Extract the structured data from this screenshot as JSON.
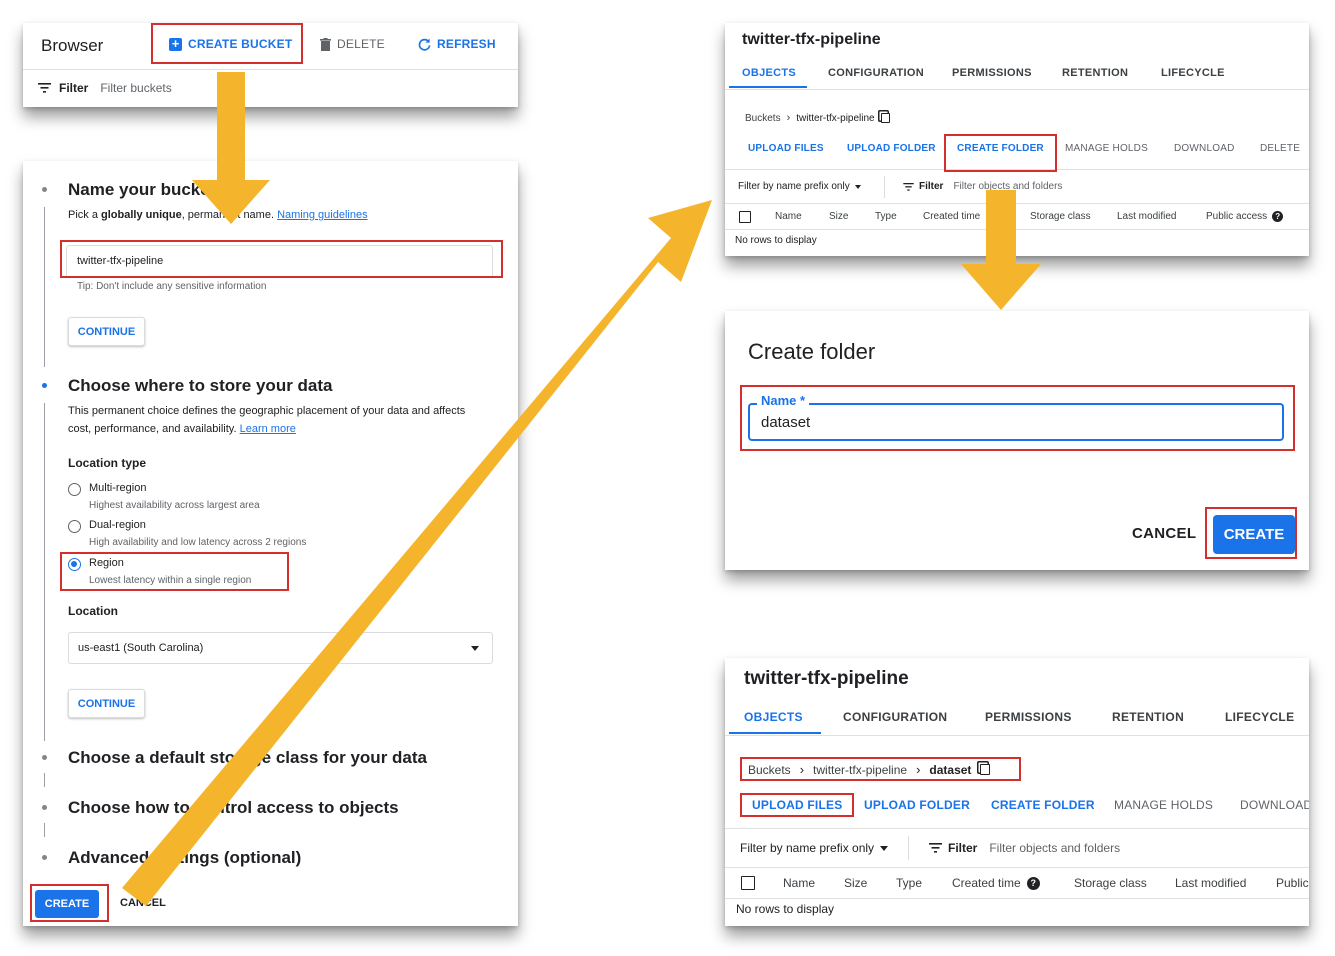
{
  "browser": {
    "title": "Browser",
    "create_bucket": "CREATE BUCKET",
    "delete": "DELETE",
    "refresh": "REFRESH",
    "filter_label": "Filter",
    "filter_placeholder": "Filter buckets"
  },
  "wizard": {
    "step1_title": "Name your bucket",
    "step1_desc_pre": "Pick a ",
    "step1_desc_bold": "globally unique",
    "step1_desc_post": ", permanent name. ",
    "step1_link": "Naming guidelines",
    "bucket_name_value": "twitter-tfx-pipeline",
    "tip": "Tip: Don't include any sensitive information",
    "continue": "CONTINUE",
    "step2_title": "Choose where to store your data",
    "step2_desc_line1": "This permanent choice defines the geographic placement of your data and affects",
    "step2_desc_line2": "cost, performance, and availability.",
    "learn_more": "Learn more",
    "location_type_label": "Location type",
    "options": [
      {
        "label": "Multi-region",
        "desc": "Highest availability across largest area"
      },
      {
        "label": "Dual-region",
        "desc": "High availability and low latency across 2 regions"
      },
      {
        "label": "Region",
        "desc": "Lowest latency within a single region"
      }
    ],
    "location_label": "Location",
    "location_value": "us-east1 (South Carolina)",
    "step3_title": "Choose a default storage class for your data",
    "step4_title": "Choose how to control access to objects",
    "step5_title": "Advanced settings (optional)",
    "create": "CREATE",
    "cancel": "CANCEL"
  },
  "bucket_top": {
    "title": "twitter-tfx-pipeline",
    "tabs": [
      "OBJECTS",
      "CONFIGURATION",
      "PERMISSIONS",
      "RETENTION",
      "LIFECYCLE"
    ],
    "breadcrumb": [
      "Buckets",
      "twitter-tfx-pipeline"
    ],
    "actions": [
      "UPLOAD FILES",
      "UPLOAD FOLDER",
      "CREATE FOLDER",
      "MANAGE HOLDS",
      "DOWNLOAD",
      "DELETE"
    ],
    "prefix_filter": "Filter by name prefix only",
    "filter_label": "Filter",
    "filter_placeholder": "Filter objects and folders",
    "columns": [
      "Name",
      "Size",
      "Type",
      "Created time",
      "Storage class",
      "Last modified",
      "Public access"
    ],
    "empty": "No rows to display"
  },
  "dialog": {
    "title": "Create folder",
    "name_label": "Name *",
    "name_value": "dataset",
    "cancel": "CANCEL",
    "create": "CREATE"
  },
  "bucket_bottom": {
    "title": "twitter-tfx-pipeline",
    "tabs": [
      "OBJECTS",
      "CONFIGURATION",
      "PERMISSIONS",
      "RETENTION",
      "LIFECYCLE"
    ],
    "breadcrumb": [
      "Buckets",
      "twitter-tfx-pipeline",
      "dataset"
    ],
    "actions": [
      "UPLOAD FILES",
      "UPLOAD FOLDER",
      "CREATE FOLDER",
      "MANAGE HOLDS",
      "DOWNLOAD"
    ],
    "prefix_filter": "Filter by name prefix only",
    "filter_label": "Filter",
    "filter_placeholder": "Filter objects and folders",
    "columns": [
      "Name",
      "Size",
      "Type",
      "Created time",
      "Storage class",
      "Last modified",
      "Public"
    ],
    "empty": "No rows to display"
  },
  "colors": {
    "accent": "#1a73e8",
    "highlight": "#d32f2f",
    "arrow": "#f4b52c"
  }
}
